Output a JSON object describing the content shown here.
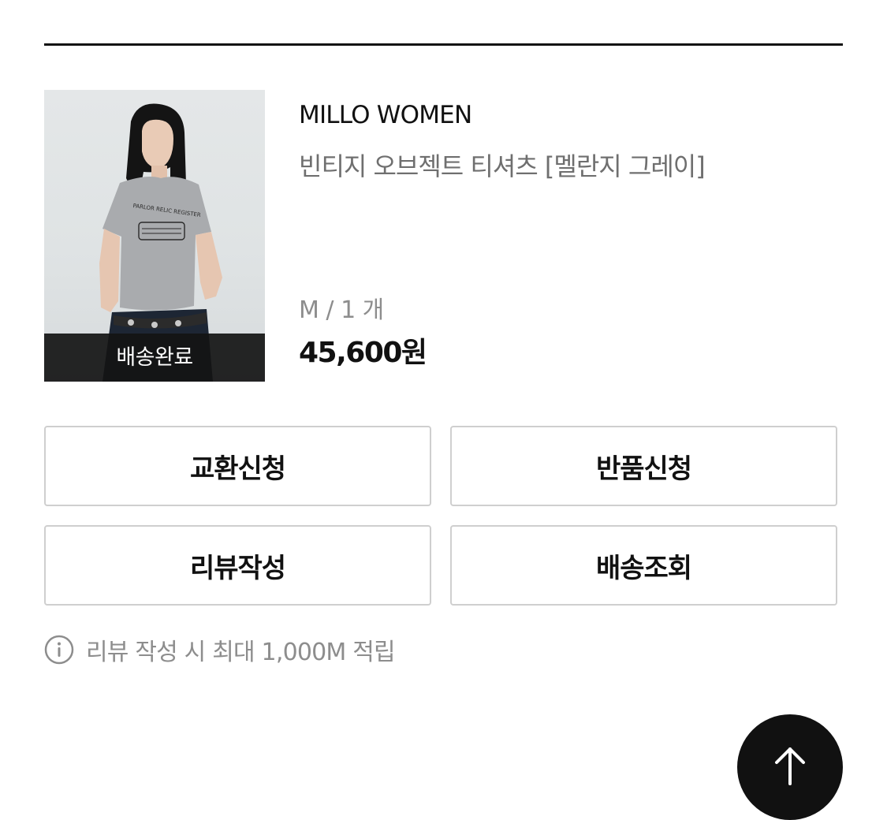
{
  "order_item": {
    "status_overlay": "배송완료",
    "brand": "MILLO WOMEN",
    "product_name": "빈티지 오브젝트 티셔츠 [멜란지 그레이]",
    "option": "M / 1 개",
    "price": "45,600원",
    "image": {
      "shirt_print_line1": "PARLOR RELIC REGISTER"
    }
  },
  "actions": {
    "exchange_label": "교환신청",
    "return_label": "반품신청",
    "review_label": "리뷰작성",
    "tracking_label": "배송조회"
  },
  "notice": {
    "icon": "info-icon",
    "text": "리뷰 작성 시 최대 1,000M 적립"
  },
  "scroll_top": {
    "icon": "arrow-up-icon"
  },
  "colors": {
    "text_primary": "#111111",
    "text_secondary": "#6f6f6f",
    "text_muted": "#8d8d8d",
    "button_border": "#cfcfcf",
    "overlay_bg": "#141414",
    "scroll_top_bg": "#111111"
  }
}
